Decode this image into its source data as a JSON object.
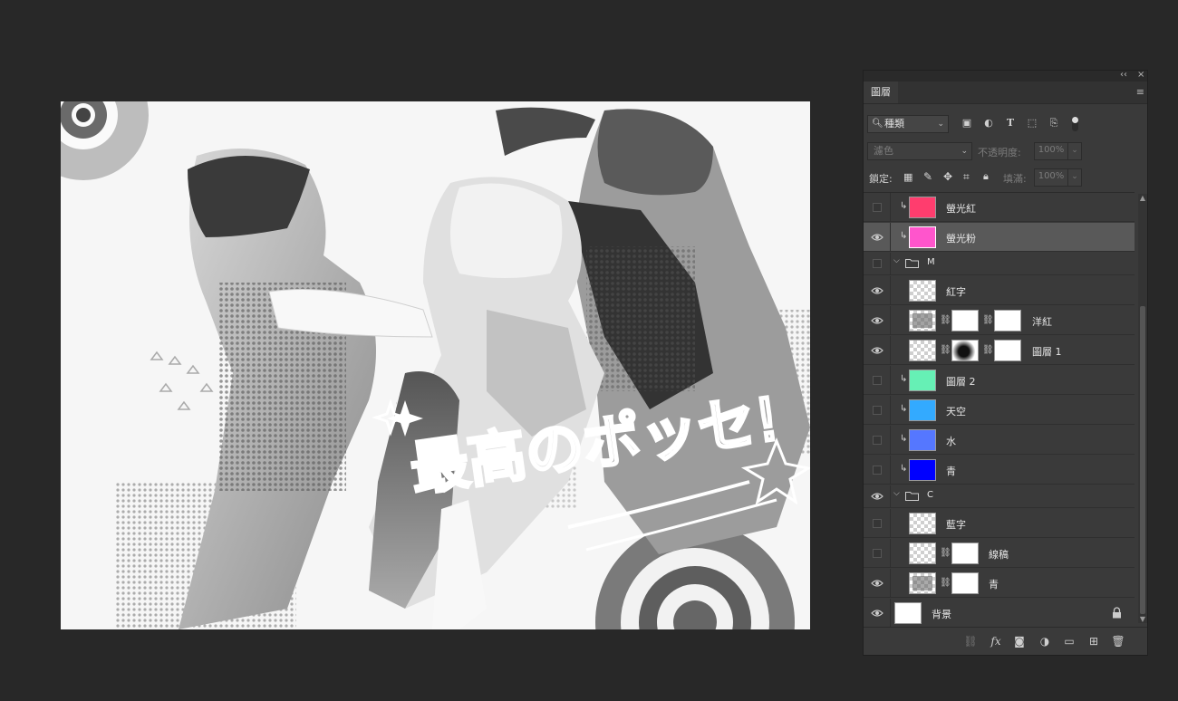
{
  "panel": {
    "tab_label": "圖層",
    "filter": {
      "kind_label": "種類"
    },
    "blend": {
      "mode": "濾色",
      "opacity_label": "不透明度:",
      "opacity_value": "100%"
    },
    "lock": {
      "label": "鎖定:",
      "fill_label": "填滿:",
      "fill_value": "100%"
    },
    "layers": [
      {
        "name": "螢光紅",
        "visible": false,
        "clipped": true,
        "thumb_color": "#ff3d6e",
        "selected": false
      },
      {
        "name": "螢光粉",
        "visible": true,
        "clipped": true,
        "thumb_color": "#ff55cc",
        "selected": true
      },
      {
        "name": "M",
        "visible": false,
        "group": true
      },
      {
        "name": "紅字",
        "visible": true
      },
      {
        "name": "洋紅",
        "visible": true
      },
      {
        "name": "圖層 1",
        "visible": true
      },
      {
        "name": "圖層 2",
        "visible": false,
        "clipped": true,
        "thumb_color": "#66f0b5"
      },
      {
        "name": "天空",
        "visible": false,
        "clipped": true,
        "thumb_color": "#33aaff"
      },
      {
        "name": "水",
        "visible": false,
        "clipped": true,
        "thumb_color": "#5577ff"
      },
      {
        "name": "青",
        "visible": false,
        "clipped": true,
        "thumb_color": "#0000ff"
      },
      {
        "name": "C",
        "visible": true,
        "group": true
      },
      {
        "name": "藍字",
        "visible": false
      },
      {
        "name": "線稿",
        "visible": false
      },
      {
        "name": "青",
        "visible": true
      },
      {
        "name": "背景",
        "visible": true,
        "locked": true
      }
    ]
  },
  "canvas": {
    "calligraphy": "最高のポッセ!"
  }
}
